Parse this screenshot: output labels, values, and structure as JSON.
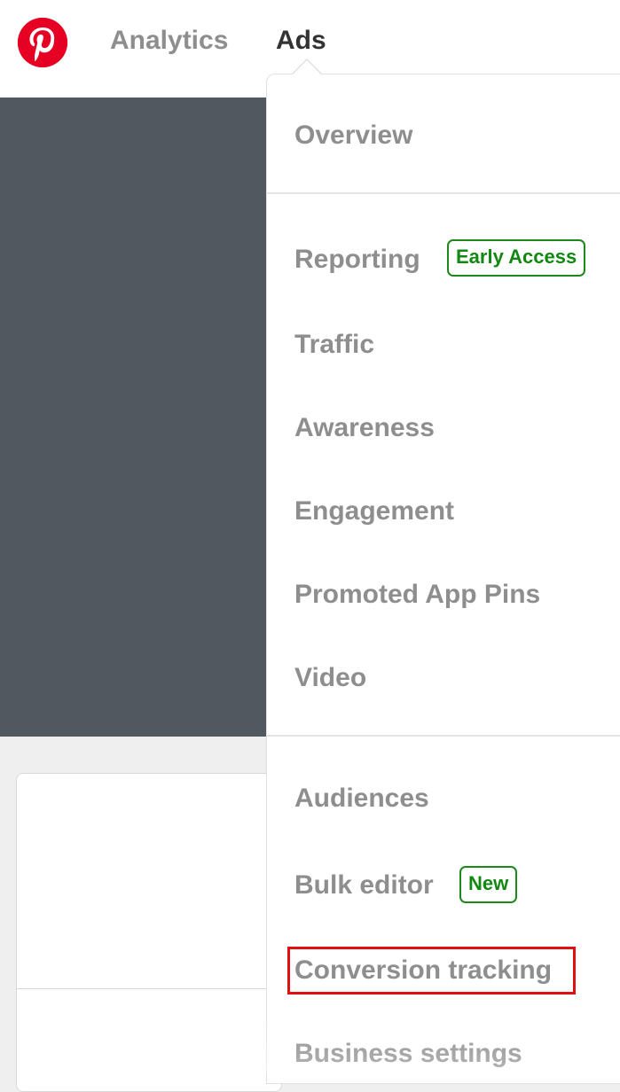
{
  "header": {
    "logo_icon": "pinterest-logo-icon",
    "nav": [
      {
        "label": "Analytics"
      },
      {
        "label": "Ads"
      }
    ]
  },
  "dropdown": {
    "items": {
      "overview": "Overview",
      "reporting": "Reporting",
      "reporting_badge": "Early Access",
      "traffic": "Traffic",
      "awareness": "Awareness",
      "engagement": "Engagement",
      "promoted_app_pins": "Promoted App Pins",
      "video": "Video",
      "audiences": "Audiences",
      "bulk_editor": "Bulk editor",
      "bulk_editor_badge": "New",
      "conversion_tracking": "Conversion tracking",
      "business_settings": "Business settings"
    },
    "highlighted_item": "Conversion tracking"
  },
  "colors": {
    "brand": "#e60023",
    "badge_green": "#118811",
    "highlight_red": "#e01010",
    "hero_background": "#525860"
  }
}
